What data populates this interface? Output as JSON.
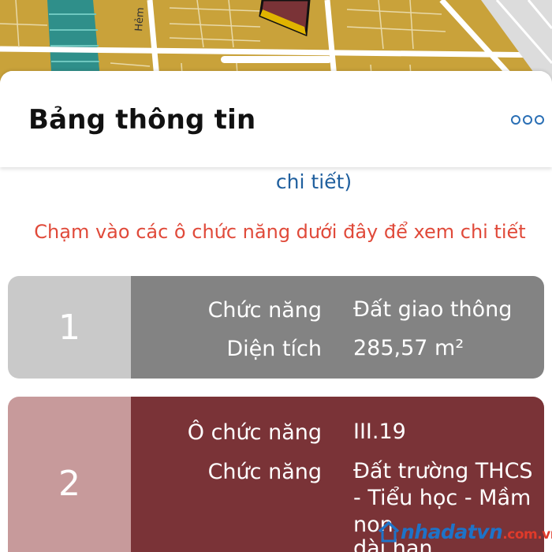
{
  "map": {
    "street_label": "Hẻm"
  },
  "sheet": {
    "title": "Bảng thông tin",
    "detail_link": "chi tiết)",
    "hint": "Chạm vào các ô chức năng dưới đây để xem chi tiết"
  },
  "cards": [
    {
      "number": "1",
      "rows": [
        {
          "label": "Chức năng",
          "value": "Đất giao thông"
        },
        {
          "label": "Diện tích",
          "value": "285,57 m²"
        }
      ],
      "colors": {
        "number_bg": "#c9c9c9",
        "body_bg": "#838383"
      }
    },
    {
      "number": "2",
      "rows": [
        {
          "label": "Ô chức năng",
          "value": "III.19"
        },
        {
          "label": "Chức năng",
          "value_lines": [
            "Đất trường THCS",
            "- Tiểu học - Mầm",
            "non",
            "dài hạn"
          ]
        }
      ],
      "colors": {
        "number_bg": "#c79a9b",
        "body_bg": "#7a3337"
      }
    }
  ],
  "watermark": {
    "brand": "nhadatvn",
    "domain": ".com.vn"
  },
  "icons": {
    "more": "more-horizontal-icon",
    "logo": "house-logo-icon"
  },
  "colors": {
    "accent": "#1f5f9e",
    "hint": "#e04a3a",
    "map_land": "#c9a23a"
  }
}
